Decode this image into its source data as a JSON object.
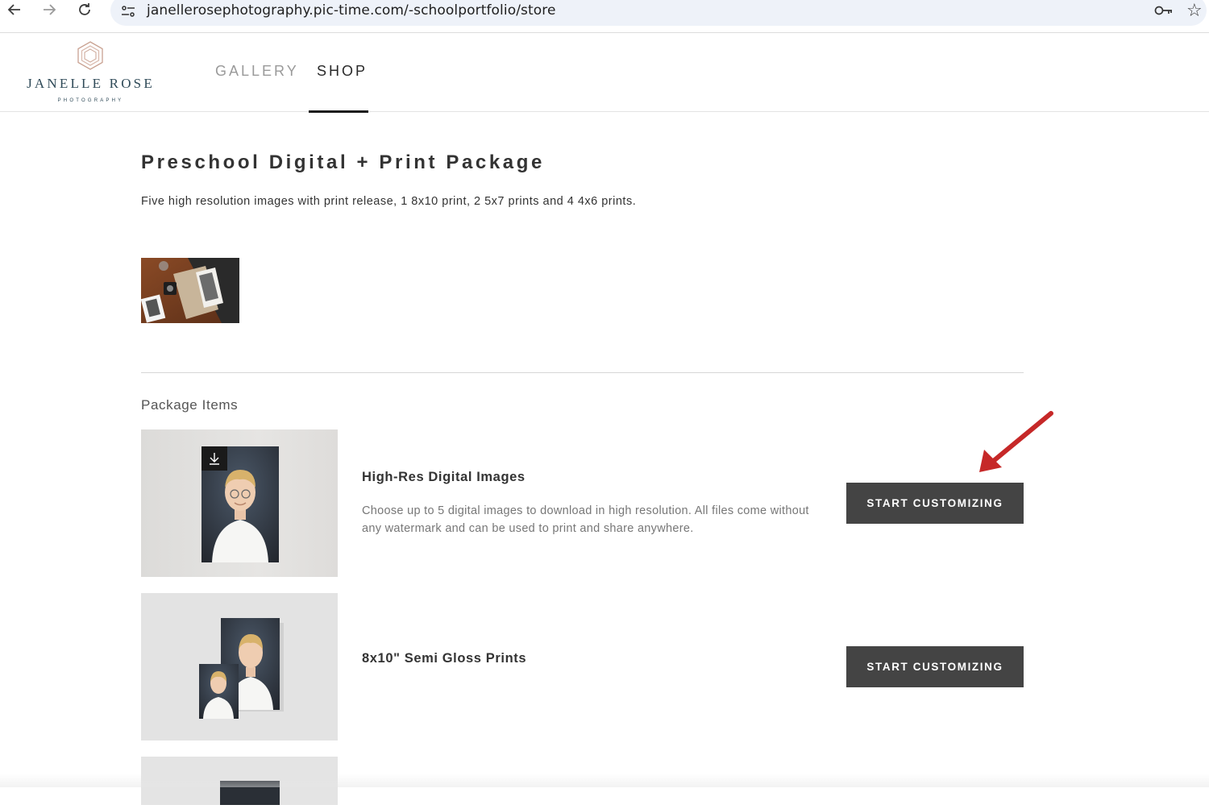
{
  "browser": {
    "url": "janellerosephotography.pic-time.com/-schoolportfolio/store",
    "back_icon": "arrow-left-icon",
    "forward_icon": "arrow-right-icon",
    "reload_icon": "reload-icon",
    "password_icon": "key-icon",
    "bookmark_icon": "star-icon"
  },
  "header": {
    "logo_name": "JANELLE ROSE",
    "logo_sub": "PHOTOGRAPHY",
    "nav": [
      {
        "label": "GALLERY",
        "active": false
      },
      {
        "label": "SHOP",
        "active": true
      }
    ]
  },
  "package": {
    "title": "Preschool Digital + Print Package",
    "description": "Five high resolution images with print release, 1 8x10 print, 2 5x7 prints and 4 4x6 prints."
  },
  "items_section": {
    "title": "Package Items",
    "items": [
      {
        "title": "High-Res Digital Images",
        "description": "Choose up to 5 digital images to download in high resolution. All files come without any watermark and can be used to print and share anywhere.",
        "button": "START CUSTOMIZING"
      },
      {
        "title": "8x10\" Semi Gloss Prints",
        "button": "START CUSTOMIZING"
      }
    ]
  },
  "colors": {
    "button_bg": "#444444",
    "annotation_arrow": "#c62828",
    "logo_text": "#2f4a58",
    "logo_mark": "#c9a191"
  }
}
